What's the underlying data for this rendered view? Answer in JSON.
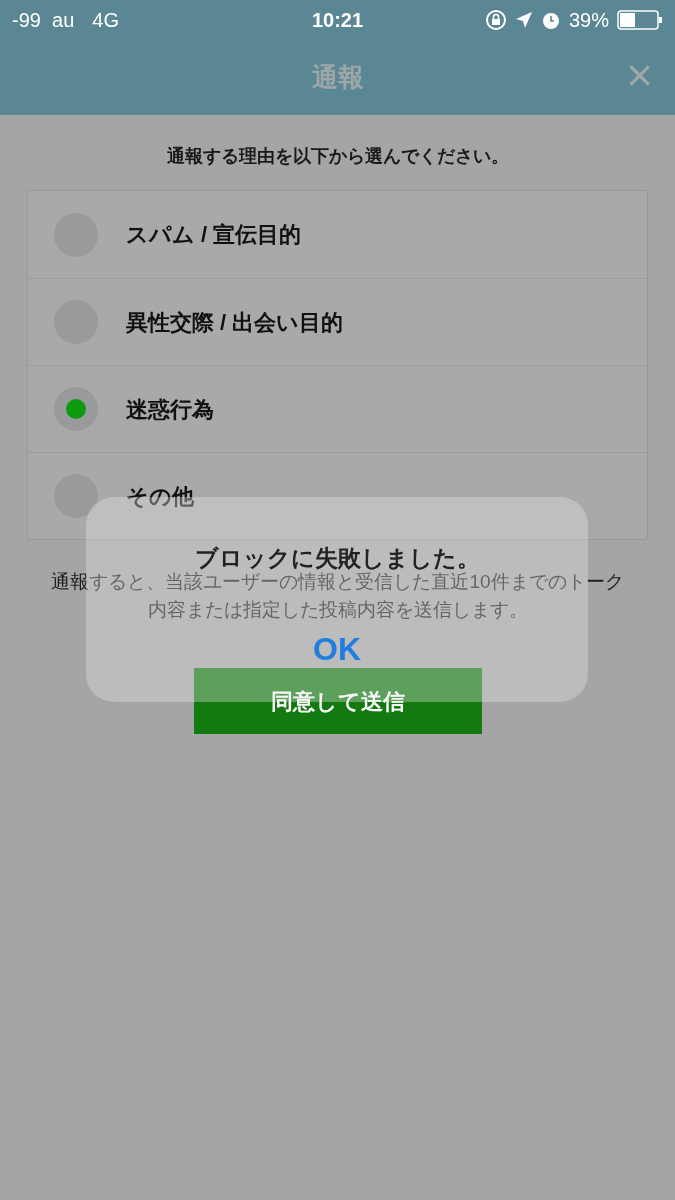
{
  "status_bar": {
    "carrier": "-99  au",
    "network": "4G",
    "time": "10:21",
    "battery": "39%"
  },
  "header": {
    "title": "通報",
    "close": "×"
  },
  "prompt": "通報する理由を以下から選んでください。",
  "reasons": [
    {
      "label": "スパム / 宣伝目的",
      "selected": false
    },
    {
      "label": "異性交際 / 出会い目的",
      "selected": false
    },
    {
      "label": "迷惑行為",
      "selected": true
    },
    {
      "label": "その他",
      "selected": false
    }
  ],
  "note": "通報すると、当該ユーザーの情報と受信した直近10件までのトーク内容または指定した投稿内容を送信します。",
  "submit": "同意して送信",
  "alert": {
    "message": "ブロックに失敗しました。",
    "button": "OK"
  }
}
